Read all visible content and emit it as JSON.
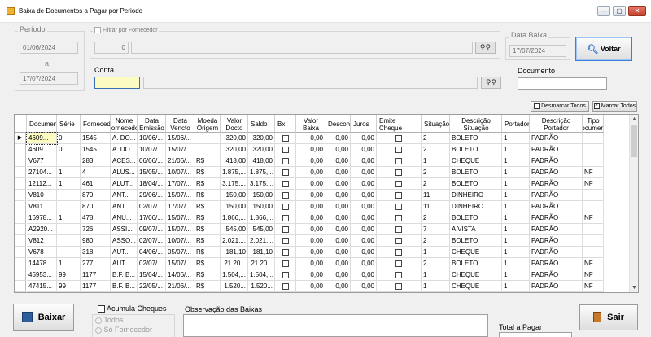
{
  "window": {
    "title": "Baixa de Documentos a Pagar por Periodo",
    "minimize": "—",
    "maximize": "▢",
    "close": "✕"
  },
  "periodo": {
    "label": "Período",
    "start": "01/06/2024",
    "sep": "a",
    "end": "17/07/2024"
  },
  "fornecedor": {
    "label": "Filtrar por Fornecedor",
    "code": "0",
    "name": ""
  },
  "conta": {
    "label": "Conta",
    "code": "",
    "name": ""
  },
  "data_baixa": {
    "label": "Data Baixa",
    "value": "17/07/2024"
  },
  "documento": {
    "label": "Documento",
    "value": ""
  },
  "buttons": {
    "voltar": "Voltar",
    "desmarcar": "Desmarcar Todos",
    "marcar": "Marcar Todos",
    "baixar": "Baixar",
    "sair": "Sair"
  },
  "grid": {
    "columns": [
      "Documento",
      "Série",
      "Fornecedor",
      "Nome Fornecedor",
      "Data Emissão",
      "Data Vencto",
      "Moeda Origem",
      "Valor Docto",
      "Saldo",
      "Bx",
      "Valor Baixa",
      "Desconto",
      "Juros",
      "Emite Cheque",
      "Situação",
      "Descrição Situação",
      "Portador",
      "Descrição Portador",
      "Tipo Documento"
    ],
    "rows": [
      [
        "4609...",
        "0",
        "1545",
        "A. DO...",
        "10/06/...",
        "15/06/...",
        "",
        "320,00",
        "320,00",
        "",
        "0,00",
        "0,00",
        "0,00",
        "",
        "2",
        "BOLETO",
        "1",
        "PADRÃO",
        ""
      ],
      [
        "4609...",
        "0",
        "1545",
        "A. DO...",
        "10/07/...",
        "15/07/...",
        "",
        "320,00",
        "320,00",
        "",
        "0,00",
        "0,00",
        "0,00",
        "",
        "2",
        "BOLETO",
        "1",
        "PADRÃO",
        ""
      ],
      [
        "V677",
        "",
        "283",
        "ACES...",
        "06/06/...",
        "21/06/...",
        "R$",
        "418,00",
        "418,00",
        "",
        "0,00",
        "0,00",
        "0,00",
        "",
        "1",
        "CHEQUE",
        "1",
        "PADRÃO",
        ""
      ],
      [
        "27104...",
        "1",
        "4",
        "ALUS...",
        "15/05/...",
        "10/07/...",
        "R$",
        "1.875,...",
        "1.875,...",
        "",
        "0,00",
        "0,00",
        "0,00",
        "",
        "2",
        "BOLETO",
        "1",
        "PADRÃO",
        "NF"
      ],
      [
        "12112...",
        "1",
        "461",
        "ALUT...",
        "18/04/...",
        "17/07/...",
        "R$",
        "3.175,...",
        "3.175,...",
        "",
        "0,00",
        "0,00",
        "0,00",
        "",
        "2",
        "BOLETO",
        "1",
        "PADRÃO",
        "NF"
      ],
      [
        "V810",
        "",
        "870",
        "ANT...",
        "29/06/...",
        "15/07/...",
        "R$",
        "150,00",
        "150,00",
        "",
        "0,00",
        "0,00",
        "0,00",
        "",
        "11",
        "DINHEIRO",
        "1",
        "PADRÃO",
        ""
      ],
      [
        "V811",
        "",
        "870",
        "ANT...",
        "02/07/...",
        "17/07/...",
        "R$",
        "150,00",
        "150,00",
        "",
        "0,00",
        "0,00",
        "0,00",
        "",
        "11",
        "DINHEIRO",
        "1",
        "PADRÃO",
        ""
      ],
      [
        "16978...",
        "1",
        "478",
        "ANU...",
        "17/06/...",
        "15/07/...",
        "R$",
        "1.866,...",
        "1.866,...",
        "",
        "0,00",
        "0,00",
        "0,00",
        "",
        "2",
        "BOLETO",
        "1",
        "PADRÃO",
        "NF"
      ],
      [
        "A2920...",
        "",
        "726",
        "ASSI...",
        "09/07/...",
        "15/07/...",
        "R$",
        "545,00",
        "545,00",
        "",
        "0,00",
        "0,00",
        "0,00",
        "",
        "7",
        "A VISTA",
        "1",
        "PADRÃO",
        ""
      ],
      [
        "V812",
        "",
        "980",
        "ASSO...",
        "02/07/...",
        "10/07/...",
        "R$",
        "2.021,...",
        "2.021,...",
        "",
        "0,00",
        "0,00",
        "0,00",
        "",
        "2",
        "BOLETO",
        "1",
        "PADRÃO",
        ""
      ],
      [
        "V678",
        "",
        "318",
        "AUT...",
        "04/06/...",
        "05/07/...",
        "R$",
        "181,10",
        "181,10",
        "",
        "0,00",
        "0,00",
        "0,00",
        "",
        "1",
        "CHEQUE",
        "1",
        "PADRÃO",
        ""
      ],
      [
        "14478...",
        "1",
        "277",
        "AUT...",
        "02/07/...",
        "15/07/...",
        "R$",
        "21.20...",
        "21.20...",
        "",
        "0,00",
        "0,00",
        "0,00",
        "",
        "2",
        "BOLETO",
        "1",
        "PADRÃO",
        "NF"
      ],
      [
        "45953...",
        "99",
        "1177",
        "B.F. B...",
        "15/04/...",
        "14/06/...",
        "R$",
        "1.504,...",
        "1.504,...",
        "",
        "0,00",
        "0,00",
        "0,00",
        "",
        "1",
        "CHEQUE",
        "1",
        "PADRÃO",
        "NF"
      ],
      [
        "47415...",
        "99",
        "1177",
        "B.F. B...",
        "22/05/...",
        "21/06/...",
        "R$",
        "1.520...",
        "1.520...",
        "",
        "0,00",
        "0,00",
        "0,00",
        "",
        "1",
        "CHEQUE",
        "1",
        "PADRÃO",
        "NF"
      ]
    ]
  },
  "bottom": {
    "acumula_label": "Acumula Cheques",
    "todos_label": "Todos",
    "so_fornecedor_label": "Só Fornecedor",
    "obs_label": "Observação das Baixas",
    "total_label": "Total a Pagar"
  },
  "icons": {
    "app": "form-icon",
    "binoculars": "binoculars-icon",
    "voltar": "magnifier-icon",
    "baixar": "floppy-disk-icon",
    "sair": "exit-door-icon"
  }
}
